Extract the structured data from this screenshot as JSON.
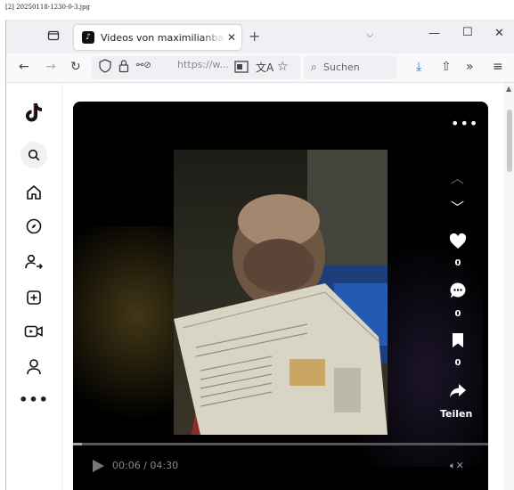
{
  "caption": "[2] 20250118-1230-0-3.jpg",
  "browser": {
    "tab_title": "Videos von maximilianbaehring",
    "url": "https://w...",
    "search_placeholder": "Suchen"
  },
  "icons": {
    "tab_overview": "tab-overview-icon",
    "favicon": "tiktok-favicon",
    "shield": "shield-icon",
    "lock": "lock-icon",
    "permissions": "permissions-icon",
    "reader": "reader-view-icon",
    "translate": "translate-icon",
    "bookmark": "bookmark-star-icon",
    "download": "download-icon",
    "share": "share-icon",
    "overflow": "chevron-overflow-icon",
    "menu": "hamburger-menu-icon"
  },
  "sidebar": {
    "items": [
      {
        "name": "tiktok-logo-icon"
      },
      {
        "name": "search-icon"
      },
      {
        "name": "home-icon"
      },
      {
        "name": "explore-icon"
      },
      {
        "name": "following-icon"
      },
      {
        "name": "upload-icon"
      },
      {
        "name": "live-icon"
      },
      {
        "name": "profile-icon"
      },
      {
        "name": "more-icon"
      }
    ]
  },
  "video": {
    "likes": "0",
    "comments": "0",
    "saves": "0",
    "share_label": "Teilen",
    "time": "00:06 / 04:30",
    "progress": 0.022
  },
  "colors": {
    "tab_bar": "#f0f0f4",
    "nav_bar": "#f9f9fb",
    "video_bg": "#000000",
    "accent": "#ffffff"
  }
}
